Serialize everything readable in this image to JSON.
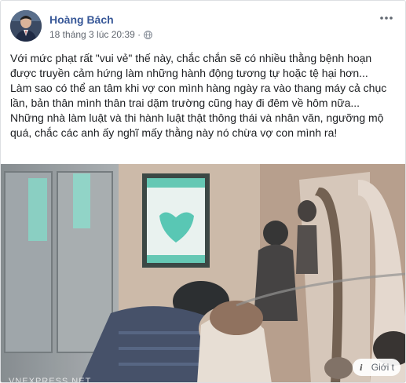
{
  "post": {
    "author": "Hoàng Bách",
    "timestamp": "18 tháng 3 lúc 20:39 ·",
    "privacy_icon": "globe-icon",
    "more_icon": "more-options-icon",
    "paragraphs": [
      "Với mức phạt rất \"vui vẻ\" thế này, chắc chắn sẽ có nhiều thằng bệnh hoạn được truyền cảm hứng làm những hành động tương tự hoặc tệ hại hơn...",
      "Làm sao có thể an tâm khi vợ con mình hàng ngày ra vào thang máy cả chục lần, bản thân mình thân trai dặm trường cũng hay đi đêm về hôm nữa...",
      "Những nhà làm luật và thi hành luật thật thông thái và nhân văn, ngưỡng mộ quá, chắc các anh ấy nghĩ mấy thằng này nó chừa vợ con mình ra!"
    ]
  },
  "media": {
    "source_label": "VNEXPRESS.NET",
    "info_label": "Giới t",
    "info_icon": "info-icon"
  }
}
